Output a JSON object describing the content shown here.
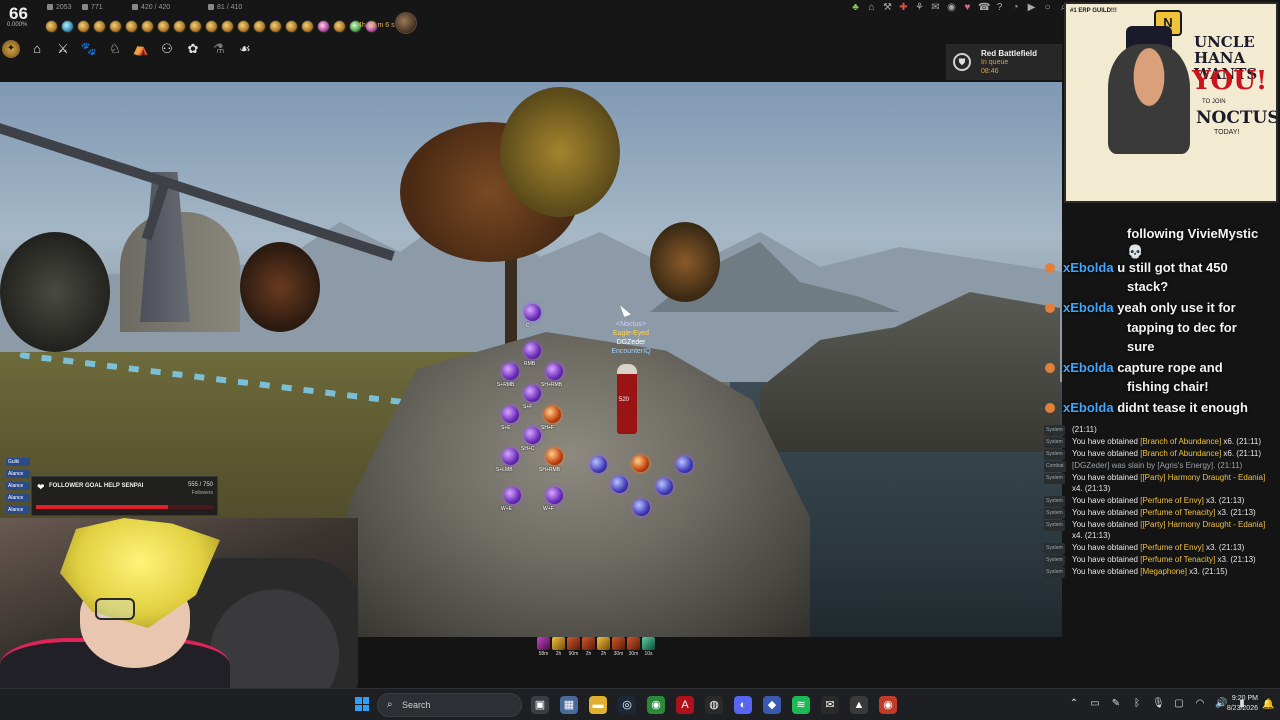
{
  "hud": {
    "level": "66",
    "level_pct": "0.000%",
    "stats": [
      {
        "icon": "attack-icon",
        "value": "2053"
      },
      {
        "icon": "defense-icon",
        "value": "771"
      },
      {
        "icon": "weight-icon",
        "value": "420 / 420"
      },
      {
        "icon": "inventory-icon",
        "value": "81 / 410"
      }
    ],
    "timer": "4h 45 m 6 s",
    "buffs": [
      "gold",
      "cyan",
      "gold",
      "gold",
      "gold",
      "gold",
      "gold",
      "gold",
      "gold",
      "gold",
      "gold",
      "gold",
      "gold",
      "gold",
      "gold",
      "gold",
      "gold",
      "pink",
      "gold",
      "grn",
      "pink"
    ],
    "menu_icons": [
      "compass-icon",
      "house-icon",
      "sword-icon",
      "paw-icon",
      "horse-icon",
      "camp-icon",
      "family-icon",
      "butterfly-icon",
      "mount-icon",
      "dragon-icon"
    ],
    "sys_icons": [
      "tree-icon",
      "shop-icon",
      "hammer-icon",
      "gift-icon",
      "quest-icon",
      "mail-icon",
      "pearl-icon",
      "heart-icon",
      "phone-icon",
      "help-icon",
      "headset-icon",
      "play-icon",
      "ring-icon",
      "search-icon"
    ]
  },
  "battlefield": {
    "title": "Red Battlefield",
    "status": "In queue",
    "time": "08:46"
  },
  "poster": {
    "guild_tag": "#1 ERP GUILD!!!",
    "badge": "N",
    "line1": "UNCLE",
    "line2": "HANA",
    "line3": "WANTS",
    "you": "YOU!",
    "join": "TO JOIN",
    "guild": "NOCTUS",
    "today": "TODAY!"
  },
  "character": {
    "guild": "<Noctus>",
    "title": "Eagle-Eyed",
    "family": "DGZeder",
    "name": "EncounterIQ",
    "hp": "520"
  },
  "skills": [
    {
      "label": "C"
    },
    {
      "label": "RMB"
    },
    {
      "label": "S+RMB"
    },
    {
      "label": "SH+RMB"
    },
    {
      "label": "S+F"
    },
    {
      "label": "S+E"
    },
    {
      "label": "SH+F"
    },
    {
      "label": "SH+C"
    },
    {
      "label": "S+LMB"
    },
    {
      "label": "SH+RMB"
    },
    {
      "label": "W+E"
    },
    {
      "label": "W+F"
    }
  ],
  "chat": [
    {
      "user": "",
      "text": "following VivieMystic"
    },
    {
      "user": "",
      "text": "💀"
    },
    {
      "user": "xEbolda",
      "text": "u still got that 450"
    },
    {
      "user": "",
      "text": "stack?"
    },
    {
      "user": "xEbolda",
      "text": "yeah only use it for"
    },
    {
      "user": "",
      "text": "tapping to dec for"
    },
    {
      "user": "",
      "text": "sure"
    },
    {
      "user": "xEbolda",
      "text": "capture rope and"
    },
    {
      "user": "",
      "text": "fishing chair!"
    },
    {
      "user": "xEbolda",
      "text": "didnt tease it enough"
    }
  ],
  "syslog": [
    {
      "tag": "System",
      "pre": "",
      "item": "",
      "post": "(21:11)",
      "cls": ""
    },
    {
      "tag": "System",
      "pre": "You have obtained ",
      "item": "[Branch of Abundance]",
      "post": " x6. (21:11)",
      "cls": ""
    },
    {
      "tag": "System",
      "pre": "You have obtained ",
      "item": "[Branch of Abundance]",
      "post": " x6. (21:11)",
      "cls": ""
    },
    {
      "tag": "Combat",
      "pre": "[DGZeder] was slain by [Agris's Energy]. (21:11)",
      "item": "",
      "post": "",
      "cls": "death"
    },
    {
      "tag": "System",
      "pre": "You have obtained ",
      "item": "[[Party] Harmony Draught - Edania]",
      "post": " x4. (21:13)",
      "cls": ""
    },
    {
      "tag": "System",
      "pre": "You have obtained ",
      "item": "[Perfume of Envy]",
      "post": " x3. (21:13)",
      "cls": ""
    },
    {
      "tag": "System",
      "pre": "You have obtained ",
      "item": "[Perfume of Tenacity]",
      "post": " x3. (21:13)",
      "cls": ""
    },
    {
      "tag": "System",
      "pre": "You have obtained ",
      "item": "[[Party] Harmony Draught - Edania]",
      "post": " x4. (21:13)",
      "cls": ""
    },
    {
      "tag": "System",
      "pre": "You have obtained ",
      "item": "[Perfume of Envy]",
      "post": " x3. (21:13)",
      "cls": ""
    },
    {
      "tag": "System",
      "pre": "You have obtained ",
      "item": "[Perfume of Tenacity]",
      "post": " x3. (21:13)",
      "cls": ""
    },
    {
      "tag": "System",
      "pre": "You have obtained ",
      "item": "[Megaphone]",
      "post": " x3. (21:15)",
      "cls": ""
    }
  ],
  "quickbar": [
    {
      "time": "58m",
      "c": "p"
    },
    {
      "time": "2h",
      "c": "y"
    },
    {
      "time": "90m",
      "c": ""
    },
    {
      "time": "2h",
      "c": ""
    },
    {
      "time": "2h",
      "c": "y"
    },
    {
      "time": "30m",
      "c": ""
    },
    {
      "time": "30m",
      "c": ""
    },
    {
      "time": "10s",
      "c": "g"
    }
  ],
  "party": [
    "Gulki",
    "Alance",
    "Alance",
    "Alance",
    "Alance"
  ],
  "goal": {
    "title": "FOLLOWER GOAL HELP SENPAI",
    "count": "555 / 750",
    "sub": "Followers",
    "progress": 0.74
  },
  "taskbar": {
    "search_placeholder": "Search",
    "time": "9:20 PM",
    "date": "8/23/2026",
    "apps": [
      {
        "icon": "task-view-icon",
        "glyph": "▣",
        "bg": "#3a3d42"
      },
      {
        "icon": "calculator-icon",
        "glyph": "▦",
        "bg": "#4a6a9a"
      },
      {
        "icon": "file-explorer-icon",
        "glyph": "▬",
        "bg": "#e0b030"
      },
      {
        "icon": "steam-icon",
        "glyph": "◎",
        "bg": "#1b2838"
      },
      {
        "icon": "chrome-icon",
        "glyph": "◉",
        "bg": "#2a8a3a"
      },
      {
        "icon": "adobe-icon",
        "glyph": "A",
        "bg": "#b0101a"
      },
      {
        "icon": "obs-icon",
        "glyph": "◍",
        "bg": "#2a2a2a"
      },
      {
        "icon": "discord-icon",
        "glyph": "◐",
        "bg": "#5865f2"
      },
      {
        "icon": "app-icon",
        "glyph": "◆",
        "bg": "#3a5ab0"
      },
      {
        "icon": "spotify-icon",
        "glyph": "≋",
        "bg": "#1db954"
      },
      {
        "icon": "mail-icon",
        "glyph": "✉",
        "bg": "#2a2a2a"
      },
      {
        "icon": "game-icon",
        "glyph": "▲",
        "bg": "#3a3a3a"
      },
      {
        "icon": "chrome-icon-2",
        "glyph": "◉",
        "bg": "#c03a2a"
      }
    ],
    "tray": [
      "chevron-up-icon",
      "usb-icon",
      "pen-icon",
      "bluetooth-icon",
      "mic-icon",
      "display-icon",
      "wifi-icon",
      "volume-icon",
      "battery-icon"
    ]
  }
}
